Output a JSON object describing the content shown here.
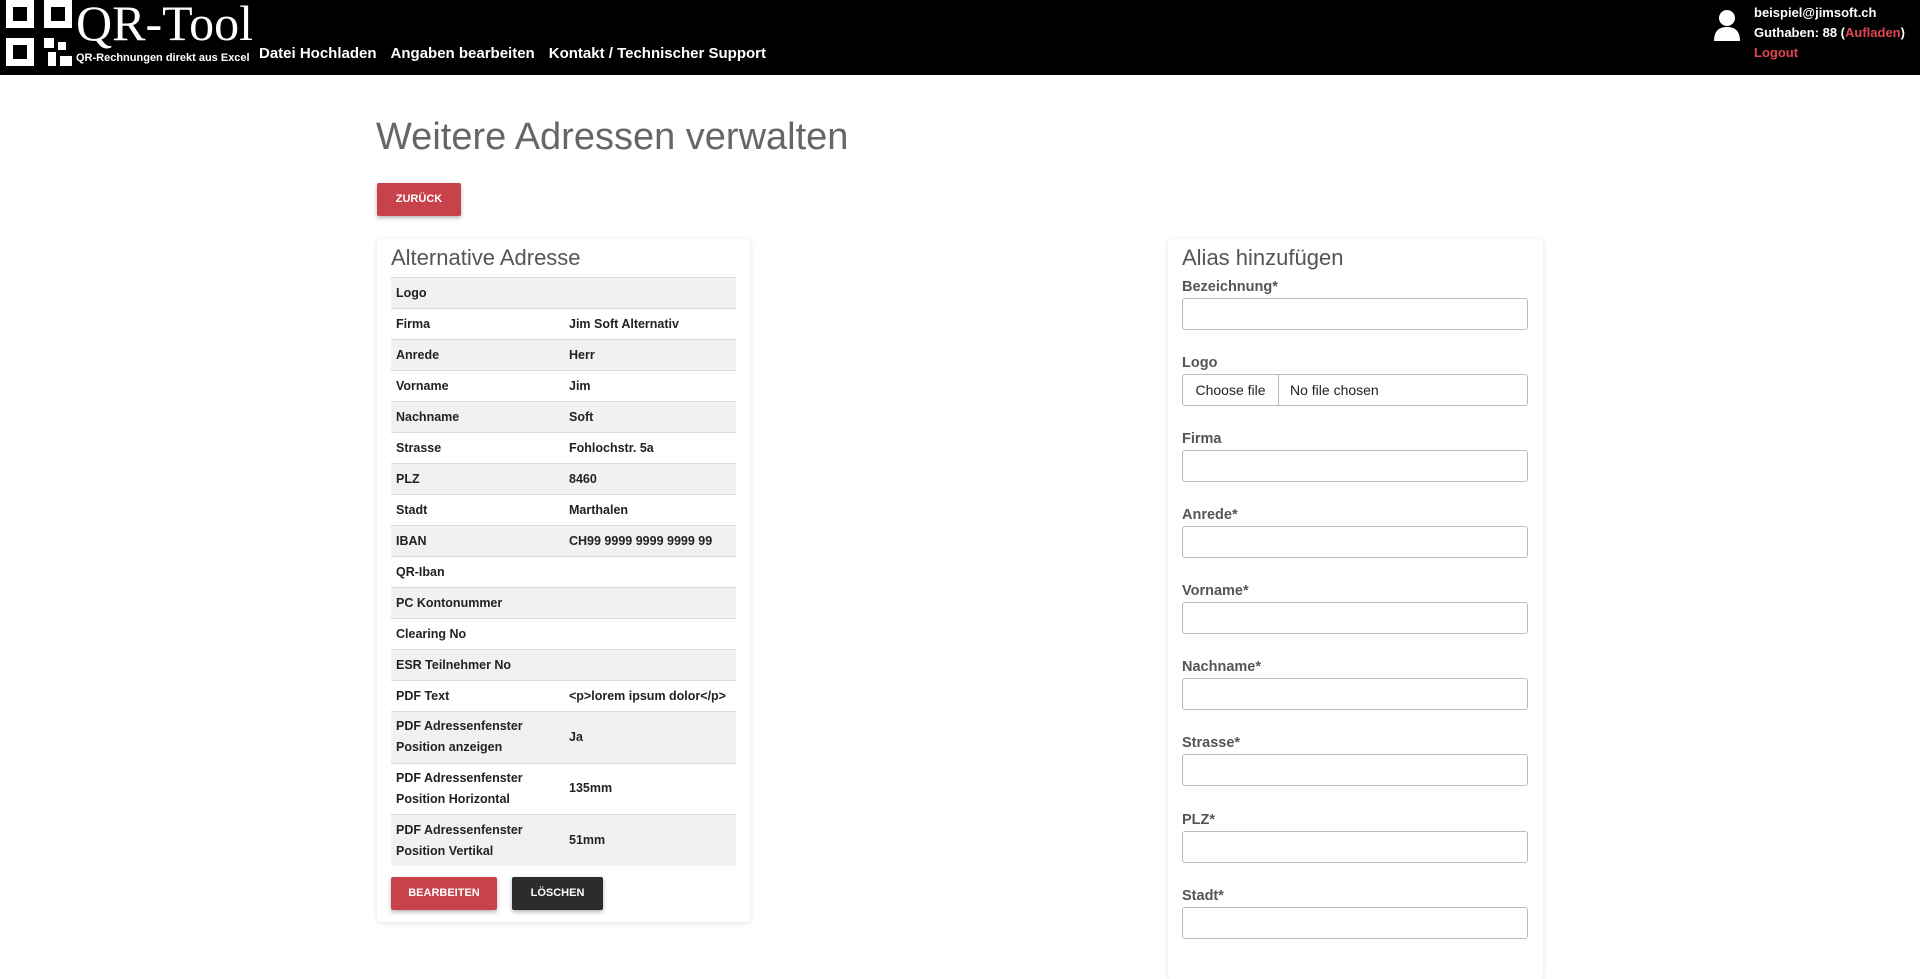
{
  "brand": {
    "title": "QR-Tool",
    "subtitle": "QR-Rechnungen direkt aus Excel"
  },
  "nav": [
    {
      "label": "Datei Hochladen"
    },
    {
      "label": "Angaben bearbeiten"
    },
    {
      "label": "Kontakt / Technischer Support"
    }
  ],
  "user": {
    "email": "beispiel@jimsoft.ch",
    "balance_prefix": "Guthaben: 88 (",
    "topup_label": "Aufladen",
    "balance_suffix": ")",
    "logout_label": "Logout"
  },
  "page": {
    "title": "Weitere Adressen verwalten",
    "back_label": "ZURÜCK"
  },
  "address_card": {
    "title": "Alternative Adresse",
    "rows": [
      {
        "label": "Logo",
        "value": ""
      },
      {
        "label": "Firma",
        "value": "Jim Soft Alternativ"
      },
      {
        "label": "Anrede",
        "value": "Herr"
      },
      {
        "label": "Vorname",
        "value": "Jim"
      },
      {
        "label": "Nachname",
        "value": "Soft"
      },
      {
        "label": "Strasse",
        "value": "Fohlochstr. 5a"
      },
      {
        "label": "PLZ",
        "value": "8460"
      },
      {
        "label": "Stadt",
        "value": "Marthalen"
      },
      {
        "label": "IBAN",
        "value": "CH99 9999 9999 9999 99"
      },
      {
        "label": "QR-Iban",
        "value": ""
      },
      {
        "label": "PC Kontonummer",
        "value": ""
      },
      {
        "label": "Clearing No",
        "value": ""
      },
      {
        "label": "ESR Teilnehmer No",
        "value": ""
      },
      {
        "label": "PDF Text",
        "value": "<p>lorem ipsum dolor</p>"
      },
      {
        "label": "PDF Adressenfenster Position anzeigen",
        "value": "Ja"
      },
      {
        "label": "PDF Adressenfenster Position Horizontal",
        "value": "135mm"
      },
      {
        "label": "PDF Adressenfenster Position Vertikal",
        "value": "51mm"
      }
    ],
    "edit_label": "BEARBEITEN",
    "delete_label": "LÖSCHEN"
  },
  "alias_form": {
    "title": "Alias hinzufügen",
    "fields": [
      {
        "label": "Bezeichnung*",
        "value": ""
      },
      {
        "label": "Logo",
        "file_button": "Choose file",
        "file_status": "No file chosen"
      },
      {
        "label": "Firma",
        "value": ""
      },
      {
        "label": "Anrede*",
        "value": ""
      },
      {
        "label": "Vorname*",
        "value": ""
      },
      {
        "label": "Nachname*",
        "value": ""
      },
      {
        "label": "Strasse*",
        "value": ""
      },
      {
        "label": "PLZ*",
        "value": ""
      },
      {
        "label": "Stadt*",
        "value": ""
      }
    ]
  },
  "colors": {
    "topbar": "#000000",
    "accent_red": "#c7424b",
    "link_red": "#e0464f",
    "dark_button": "#2c2c2c"
  }
}
